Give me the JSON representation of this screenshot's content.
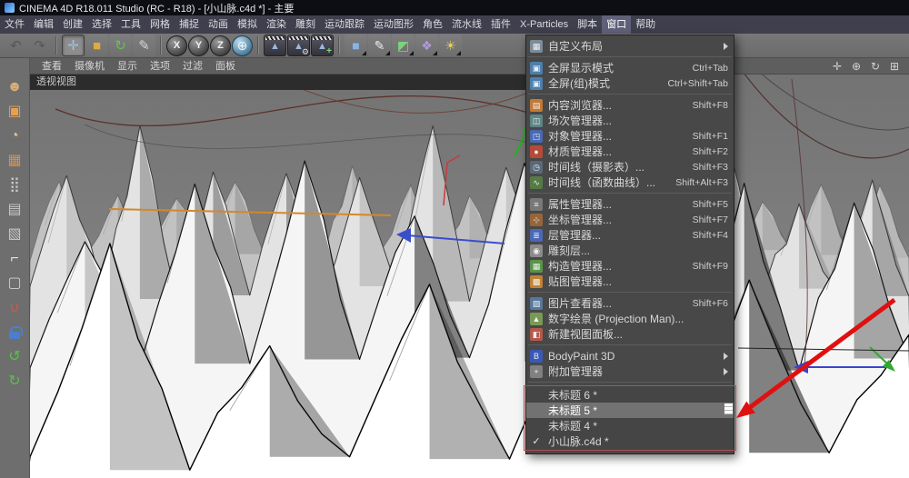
{
  "titlebar": {
    "title": "CINEMA 4D R18.011 Studio (RC - R18) - [小山脉.c4d *] - 主要"
  },
  "menubar": {
    "items": [
      "文件",
      "编辑",
      "创建",
      "选择",
      "工具",
      "网格",
      "捕捉",
      "动画",
      "模拟",
      "渲染",
      "雕刻",
      "运动跟踪",
      "运动图形",
      "角色",
      "流水线",
      "插件",
      "X-Particles",
      "脚本",
      "窗口",
      "帮助"
    ],
    "active_index": 18
  },
  "toolbar": {
    "items": [
      {
        "name": "undo-button",
        "glyph": "↶",
        "kind": "plain dim"
      },
      {
        "name": "redo-button",
        "glyph": "↷",
        "kind": "plain dim"
      },
      {
        "kind": "sep"
      },
      {
        "name": "move-tool-button",
        "glyph": "✛",
        "kind": "tool active",
        "color": "#9fc0e8"
      },
      {
        "name": "scale-tool-button",
        "glyph": "■",
        "kind": "tool",
        "color": "#e0aa3e"
      },
      {
        "name": "rotate-tool-button",
        "glyph": "↻",
        "kind": "tool",
        "color": "#66c24e"
      },
      {
        "name": "last-used-tool-button",
        "glyph": "✎",
        "kind": "tool",
        "color": "#d8d8d8"
      },
      {
        "kind": "sep"
      },
      {
        "name": "x-axis-lock-button",
        "glyph": "X",
        "kind": "sphere"
      },
      {
        "name": "y-axis-lock-button",
        "glyph": "Y",
        "kind": "sphere"
      },
      {
        "name": "z-axis-lock-button",
        "glyph": "Z",
        "kind": "sphere"
      },
      {
        "name": "coordinate-system-button",
        "glyph": "⊕",
        "kind": "globe"
      },
      {
        "kind": "sep"
      },
      {
        "name": "render-view-button",
        "glyph": "▲",
        "kind": "render"
      },
      {
        "name": "render-settings-button",
        "glyph": "▲",
        "kind": "render gear"
      },
      {
        "name": "render-queue-button",
        "glyph": "▲",
        "kind": "render plus"
      },
      {
        "kind": "sep"
      },
      {
        "name": "primitive-cube-button",
        "glyph": "■",
        "kind": "prim flyout",
        "color": "#86b4e8"
      },
      {
        "name": "spline-pen-button",
        "glyph": "✎",
        "kind": "prim flyout",
        "color": "#ececec"
      },
      {
        "name": "generator-button",
        "glyph": "◩",
        "kind": "prim flyout",
        "color": "#7ed27e"
      },
      {
        "name": "deformer-button",
        "glyph": "❖",
        "kind": "prim flyout",
        "color": "#b29ae0"
      },
      {
        "name": "environment-button",
        "glyph": "☀",
        "kind": "prim flyout",
        "color": "#e8d060"
      }
    ]
  },
  "viewport": {
    "title": "透视视图",
    "menus": [
      "查看",
      "摄像机",
      "显示",
      "选项",
      "过滤",
      "面板"
    ],
    "nav_icons": [
      {
        "name": "pan-view-icon",
        "glyph": "✛"
      },
      {
        "name": "zoom-view-icon",
        "glyph": "⊕"
      },
      {
        "name": "rotate-view-icon",
        "glyph": "↻"
      },
      {
        "name": "toggle-views-icon",
        "glyph": "⊞"
      }
    ]
  },
  "sidebar": {
    "icons": [
      {
        "name": "bodypaint-mode-icon",
        "glyph": "☻",
        "color": "#d8b078"
      },
      {
        "name": "make-editable-icon",
        "glyph": "▣",
        "color": "#e8a050"
      },
      {
        "name": "model-mode-icon",
        "glyph": "◔",
        "color": "#e8c088"
      },
      {
        "name": "texture-mode-icon",
        "glyph": "▦",
        "color": "#e09040"
      },
      {
        "name": "point-mode-icon",
        "glyph": "⣿",
        "color": "#c8c8c8"
      },
      {
        "name": "edge-mode-icon",
        "glyph": "▤",
        "color": "#c8c8c8"
      },
      {
        "name": "polygon-mode-icon",
        "glyph": "▧",
        "color": "#c8c8c8"
      },
      {
        "name": "axis-mode-icon",
        "glyph": "⌐",
        "color": "#e0e0e0"
      },
      {
        "name": "viewport-select-icon",
        "glyph": "▢",
        "color": "#d0d0d0"
      },
      {
        "name": "snap-icon",
        "glyph": "∪",
        "color": "#d05848"
      },
      {
        "name": "lock-icon",
        "kind": "lock"
      },
      {
        "name": "rotate-normals-icon",
        "glyph": "↺",
        "color": "#58c048"
      },
      {
        "name": "scale-normals-icon",
        "glyph": "↻",
        "color": "#58c048"
      }
    ]
  },
  "window_menu": {
    "groups": [
      {
        "items": [
          {
            "label": "自定义布局",
            "sub": true,
            "icon": "layout",
            "ic": "#7d8c9a",
            "ig": "▦"
          }
        ]
      },
      {
        "items": [
          {
            "label": "全屏显示模式",
            "sc": "Ctrl+Tab",
            "icon": "fullscreen",
            "ic": "#4d7fae",
            "ig": "▣"
          },
          {
            "label": "全屏(组)模式",
            "sc": "Ctrl+Shift+Tab",
            "icon": "fullscreen-group",
            "ic": "#4d7fae",
            "ig": "▣"
          }
        ]
      },
      {
        "items": [
          {
            "label": "内容浏览器...",
            "sc": "Shift+F8",
            "icon": "content-browser",
            "ic": "#c07a36",
            "ig": "▤"
          },
          {
            "label": "场次管理器...",
            "icon": "take-manager",
            "ic": "#5f8585",
            "ig": "◫"
          },
          {
            "label": "对象管理器...",
            "sc": "Shift+F1",
            "icon": "object-manager",
            "ic": "#4a68b4",
            "ig": "◳"
          },
          {
            "label": "材质管理器...",
            "sc": "Shift+F2",
            "icon": "material-manager",
            "ic": "#b44a38",
            "ig": "●"
          },
          {
            "label": "时间线（摄影表）...",
            "sc": "Shift+F3",
            "icon": "timeline-dopesheet",
            "ic": "#5a6878",
            "ig": "◷"
          },
          {
            "label": "时间线（函数曲线）...",
            "sc": "Shift+Alt+F3",
            "icon": "timeline-fcurve",
            "ic": "#567a46",
            "ig": "∿"
          }
        ]
      },
      {
        "items": [
          {
            "label": "属性管理器...",
            "sc": "Shift+F5",
            "icon": "attribute-manager",
            "ic": "#787878",
            "ig": "≡"
          },
          {
            "label": "坐标管理器...",
            "sc": "Shift+F7",
            "icon": "coordinate-manager",
            "ic": "#96663a",
            "ig": "⊹"
          },
          {
            "label": "层管理器...",
            "sc": "Shift+F4",
            "icon": "layer-manager",
            "ic": "#4a68b4",
            "ig": "≣"
          },
          {
            "label": "雕刻层...",
            "icon": "sculpt-layers",
            "ic": "#8a8a8a",
            "ig": "◉"
          },
          {
            "label": "构造管理器...",
            "sc": "Shift+F9",
            "icon": "structure-manager",
            "ic": "#5a9448",
            "ig": "▦"
          },
          {
            "label": "贴图管理器...",
            "icon": "uv-manager",
            "ic": "#c08236",
            "ig": "▩"
          }
        ]
      },
      {
        "items": [
          {
            "label": "图片查看器...",
            "sc": "Shift+F6",
            "icon": "picture-viewer",
            "ic": "#56789a",
            "ig": "▨"
          },
          {
            "label": "数字绘景 (Projection Man)...",
            "icon": "projection-man",
            "ic": "#789a56",
            "ig": "▲"
          },
          {
            "label": "新建视图面板...",
            "icon": "new-view-panel",
            "ic": "#b4584a",
            "ig": "◧"
          }
        ]
      },
      {
        "items": [
          {
            "label": "BodyPaint 3D",
            "sub": true,
            "icon": "bodypaint",
            "ic": "#3a58b4",
            "ig": "B"
          },
          {
            "label": "附加管理器",
            "sub": true,
            "icon": "additional-managers",
            "ic": "#808080",
            "ig": "+"
          }
        ]
      },
      {
        "boxed": true,
        "items": [
          {
            "label": "未标题 6 *"
          },
          {
            "label": "未标题 5 *",
            "hl": true
          },
          {
            "label": "未标题 4 *"
          },
          {
            "label": "小山脉.c4d *",
            "check": true
          }
        ]
      }
    ]
  },
  "annotation": {
    "color": "#e01010",
    "box_color": "#b05050"
  }
}
